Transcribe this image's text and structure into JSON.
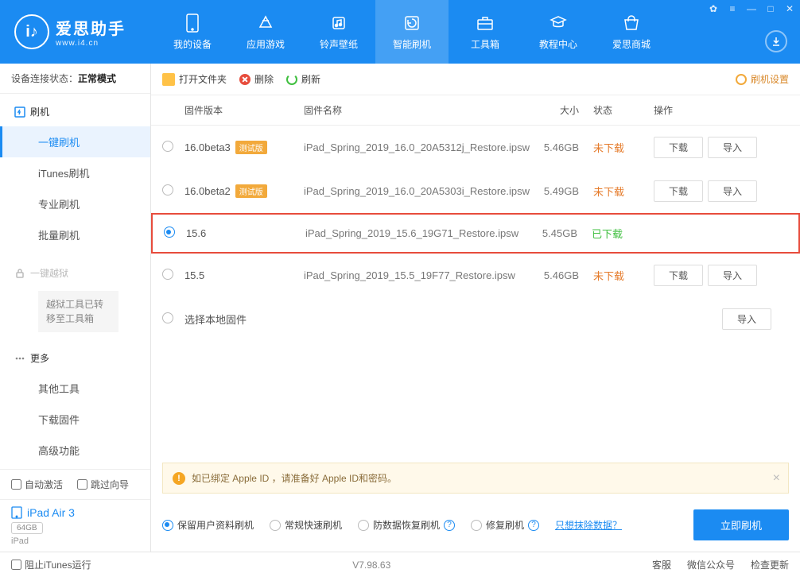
{
  "brand": {
    "title": "爱思助手",
    "url": "www.i4.cn"
  },
  "nav": [
    {
      "id": "device",
      "label": "我的设备"
    },
    {
      "id": "apps",
      "label": "应用游戏"
    },
    {
      "id": "ringtones",
      "label": "铃声壁纸"
    },
    {
      "id": "flash",
      "label": "智能刷机"
    },
    {
      "id": "toolbox",
      "label": "工具箱"
    },
    {
      "id": "tutorial",
      "label": "教程中心"
    },
    {
      "id": "store",
      "label": "爱思商城"
    }
  ],
  "sidebar": {
    "status_label": "设备连接状态：",
    "status_value": "正常模式",
    "flash_head": "刷机",
    "items": [
      "一键刷机",
      "iTunes刷机",
      "专业刷机",
      "批量刷机"
    ],
    "jailbreak_head": "一键越狱",
    "jailbreak_note": "越狱工具已转移至工具箱",
    "more_head": "更多",
    "more_items": [
      "其他工具",
      "下载固件",
      "高级功能"
    ],
    "auto_activate": "自动激活",
    "skip_guide": "跳过向导",
    "device_name": "iPad Air 3",
    "device_cap": "64GB",
    "device_type": "iPad"
  },
  "toolbar": {
    "open_folder": "打开文件夹",
    "delete": "删除",
    "refresh": "刷新",
    "settings": "刷机设置"
  },
  "columns": {
    "version": "固件版本",
    "name": "固件名称",
    "size": "大小",
    "status": "状态",
    "ops": "操作"
  },
  "rows": [
    {
      "ver": "16.0beta3",
      "beta": "测试版",
      "name": "iPad_Spring_2019_16.0_20A5312j_Restore.ipsw",
      "size": "5.46GB",
      "status": "未下载",
      "status_class": "undl",
      "ops": true
    },
    {
      "ver": "16.0beta2",
      "beta": "测试版",
      "name": "iPad_Spring_2019_16.0_20A5303i_Restore.ipsw",
      "size": "5.49GB",
      "status": "未下载",
      "status_class": "undl",
      "ops": true
    },
    {
      "ver": "15.6",
      "beta": "",
      "name": "iPad_Spring_2019_15.6_19G71_Restore.ipsw",
      "size": "5.45GB",
      "status": "已下载",
      "status_class": "dl",
      "ops": false,
      "selected": true
    },
    {
      "ver": "15.5",
      "beta": "",
      "name": "iPad_Spring_2019_15.5_19F77_Restore.ipsw",
      "size": "5.46GB",
      "status": "未下载",
      "status_class": "undl",
      "ops": true
    },
    {
      "ver": "选择本地固件",
      "beta": "",
      "name": "",
      "size": "",
      "status": "",
      "status_class": "",
      "ops_import_only": true
    }
  ],
  "buttons": {
    "download": "下载",
    "import": "导入"
  },
  "notice": "如已绑定 Apple ID ，请准备好 Apple ID和密码。",
  "actions": {
    "opts": [
      "保留用户资料刷机",
      "常规快速刷机",
      "防数据恢复刷机",
      "修复刷机"
    ],
    "erase_link": "只想抹除数据？",
    "flash_now": "立即刷机"
  },
  "footer": {
    "block_itunes": "阻止iTunes运行",
    "version": "V7.98.63",
    "links": [
      "客服",
      "微信公众号",
      "检查更新"
    ]
  }
}
